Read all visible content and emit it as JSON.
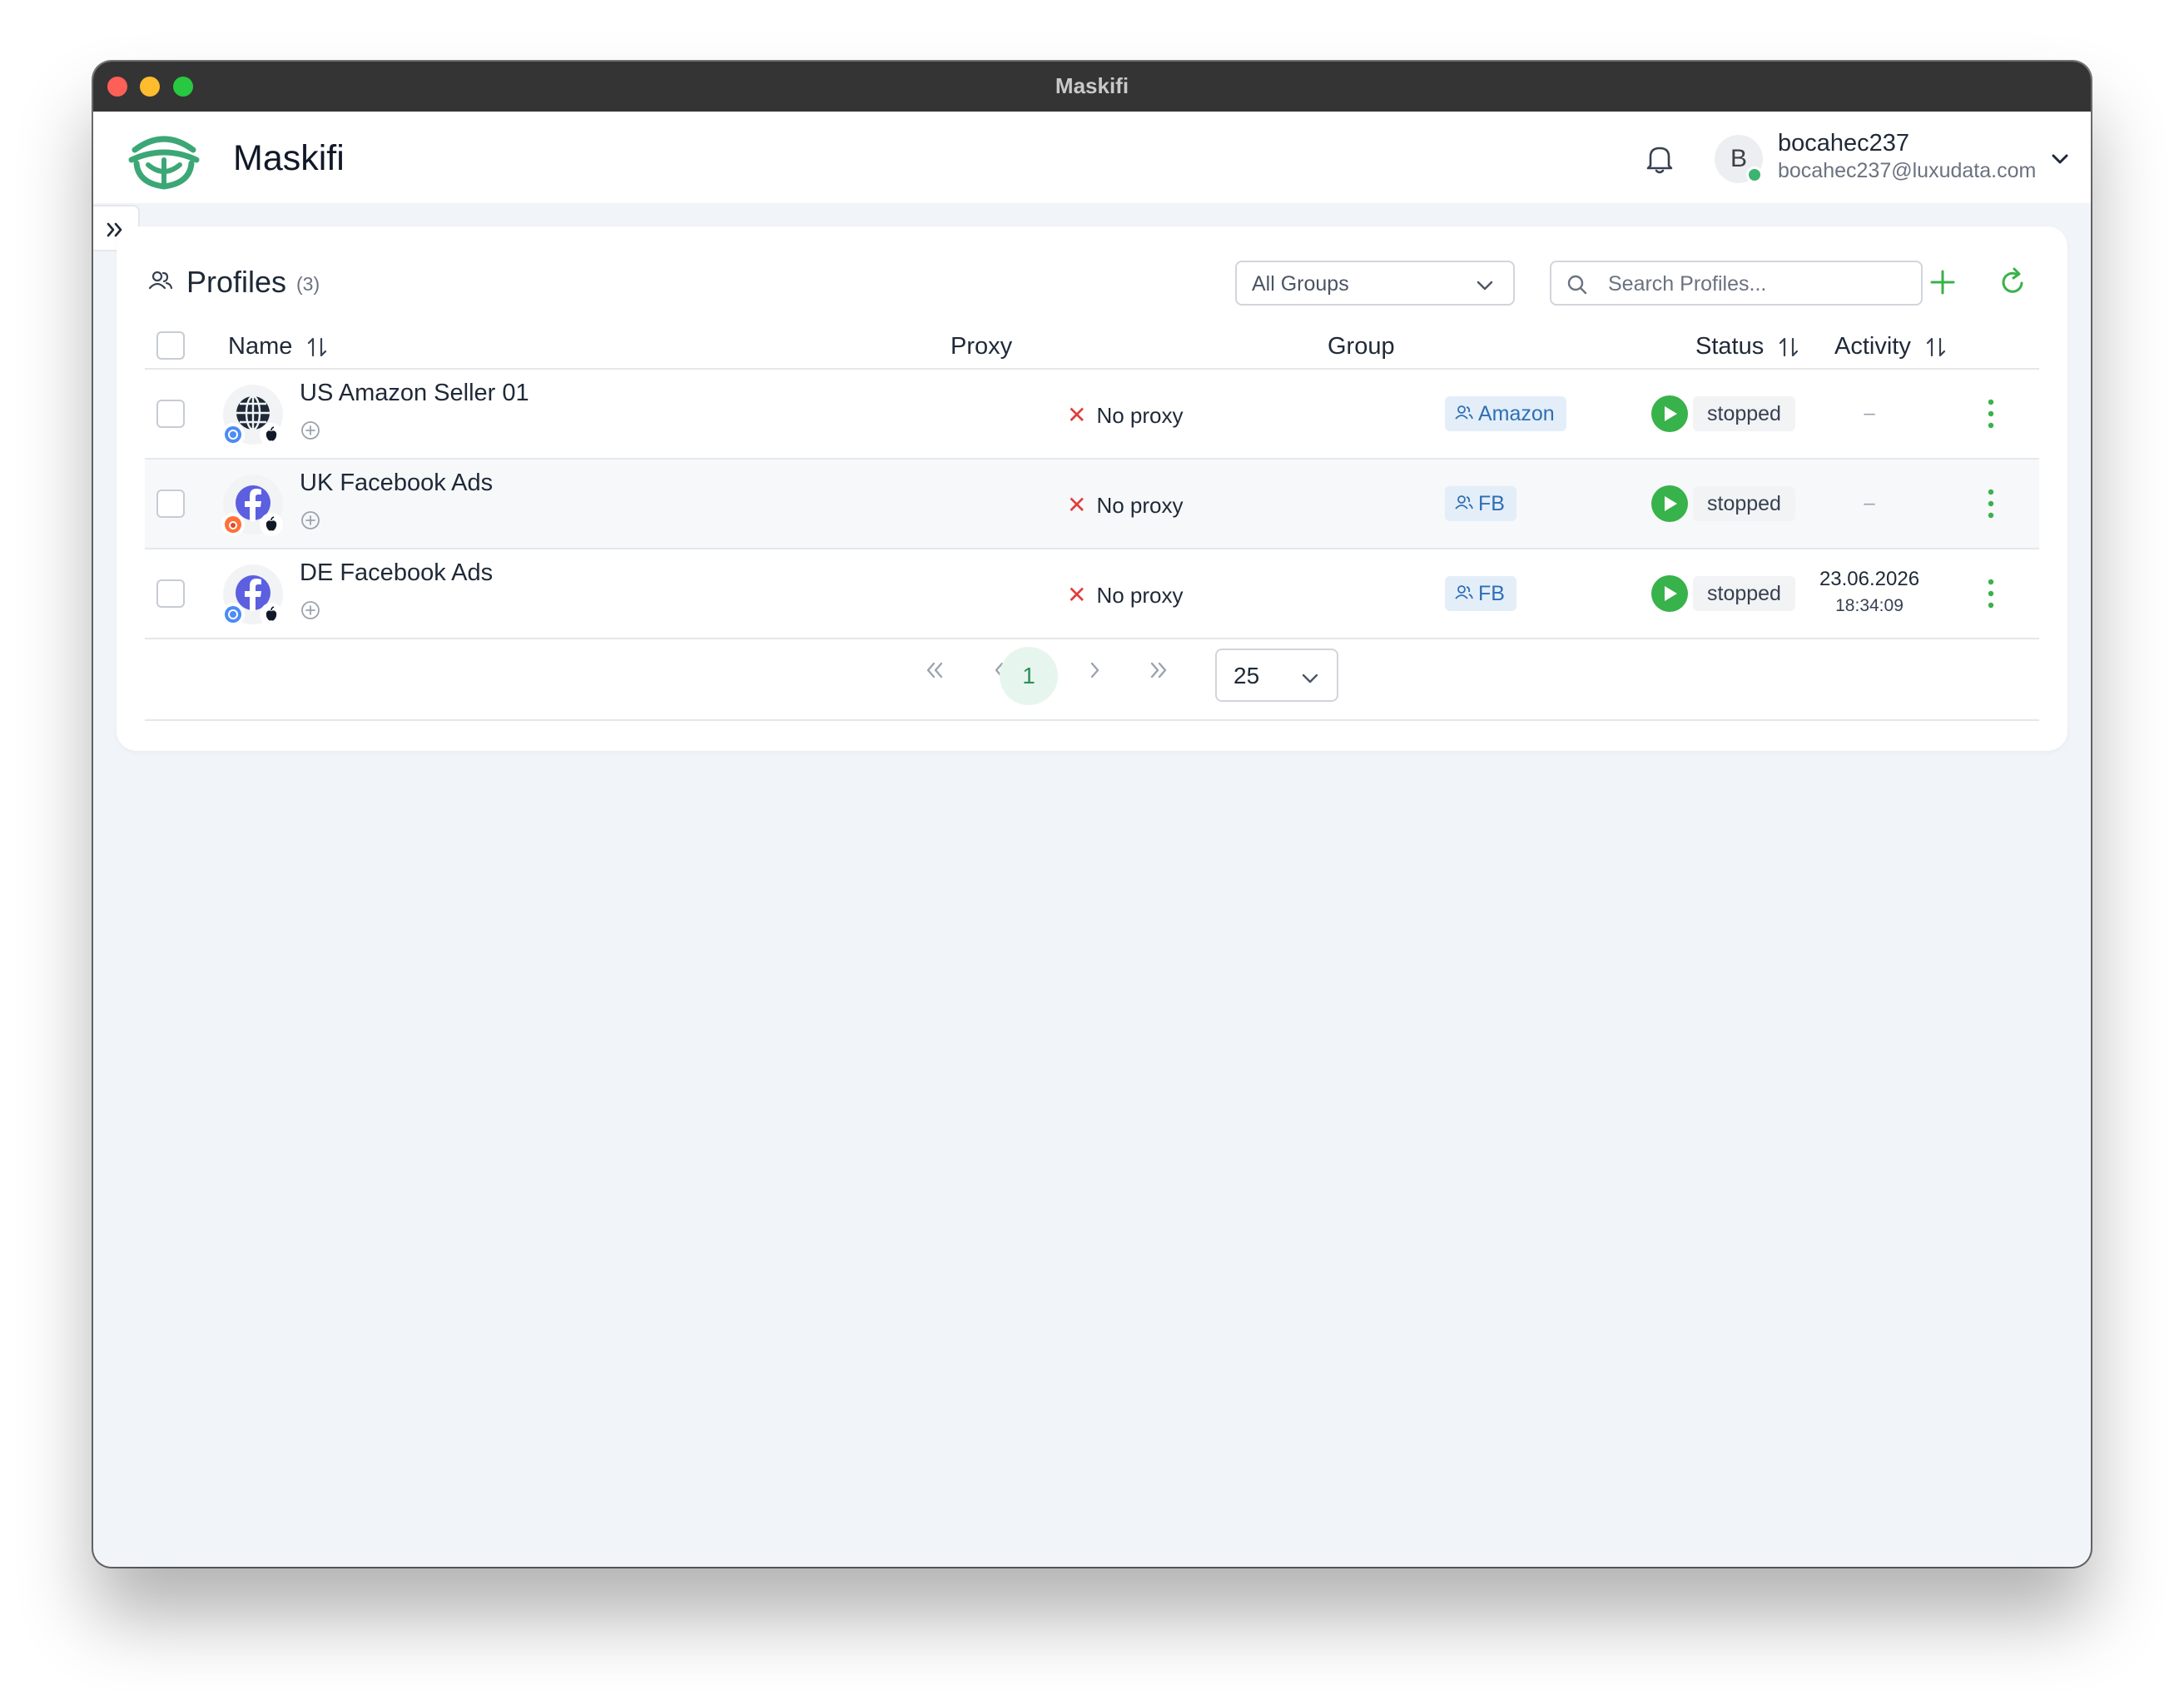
{
  "window": {
    "title": "Maskifi"
  },
  "app": {
    "name": "Maskifi"
  },
  "user": {
    "initial": "B",
    "name": "bocahec237",
    "email": "bocahec237@luxudata.com",
    "online_color": "#3cb371"
  },
  "profiles_panel": {
    "title": "Profiles",
    "count": "(3)",
    "groups_filter": {
      "selected": "All Groups"
    },
    "search": {
      "placeholder": "Search Profiles...",
      "value": ""
    },
    "columns": {
      "name": "Name",
      "proxy": "Proxy",
      "group": "Group",
      "status": "Status",
      "activity": "Activity"
    },
    "rows": [
      {
        "name": "US Amazon Seller 01",
        "avatar_icon": "globe-icon",
        "browser_icon": "chrome-icon",
        "os_icon": "apple-icon",
        "proxy": "No proxy",
        "group": "Amazon",
        "status": "stopped",
        "activity_date": "",
        "activity_time": "",
        "activity_empty": "–"
      },
      {
        "name": "UK Facebook Ads",
        "avatar_icon": "facebook-icon",
        "browser_icon": "firefox-icon",
        "os_icon": "apple-icon",
        "proxy": "No proxy",
        "group": "FB",
        "status": "stopped",
        "activity_date": "",
        "activity_time": "",
        "activity_empty": "–"
      },
      {
        "name": "DE Facebook Ads",
        "avatar_icon": "facebook-icon",
        "browser_icon": "chrome-icon",
        "os_icon": "apple-icon",
        "proxy": "No proxy",
        "group": "FB",
        "status": "stopped",
        "activity_date": "23.06.2026",
        "activity_time": "18:34:09",
        "activity_empty": ""
      }
    ],
    "pagination": {
      "current_page": "1",
      "per_page": "25"
    }
  },
  "colors": {
    "accent": "#38b24a",
    "brand": "#3ca776",
    "proxy_error": "#e03e3e",
    "group_tag_bg": "#e3eef9",
    "group_tag_text": "#2f6fb3"
  }
}
